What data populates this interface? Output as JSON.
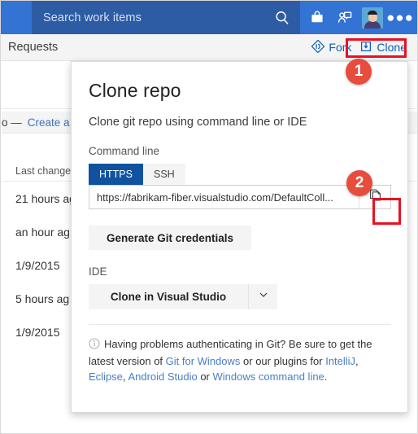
{
  "header": {
    "search_placeholder": "Search work items",
    "icons": [
      "search-icon",
      "marketplace-icon",
      "feedback-icon",
      "avatar",
      "more-actions-icon"
    ],
    "blue_left": "#3273d4",
    "blue_search": "#2d5ca5"
  },
  "subbar": {
    "title": "Requests",
    "fork_label": "Fork",
    "clone_label": "Clone",
    "link_color": "#0a60b5"
  },
  "background": {
    "create_pr_prefix": "o —",
    "create_pr_link": "Create a p",
    "column_header": "Last change",
    "rows": [
      "21 hours ag",
      "an hour ag",
      "1/9/2015",
      "5 hours ag",
      "1/9/2015"
    ]
  },
  "dialog": {
    "title": "Clone repo",
    "subtitle": "Clone git repo using command line or IDE",
    "command_line_label": "Command line",
    "tabs": [
      {
        "label": "HTTPS",
        "active": true
      },
      {
        "label": "SSH",
        "active": false
      }
    ],
    "url_value": "https://fabrikam-fiber.visualstudio.com/DefaultColl...",
    "copy_icon": "copy-icon",
    "generate_button": "Generate Git credentials",
    "ide_label": "IDE",
    "ide_button": "Clone in Visual Studio",
    "ide_caret": "chevron-down-icon",
    "footer": {
      "info_icon": "info-icon",
      "text_1": "Having problems authenticating in Git? Be sure to get the latest version of ",
      "link_1": "Git for Windows",
      "text_2": " or our plugins for ",
      "link_2": "IntelliJ",
      "text_3": ", ",
      "link_3": "Eclipse",
      "text_4": ", ",
      "link_4": "Android Studio",
      "text_5": " or ",
      "link_5": "Windows command line",
      "text_6": "."
    }
  },
  "annotations": {
    "marker_1": "1",
    "marker_2": "2",
    "highlight_color": "#e81123",
    "badge_color": "#e74c3c"
  }
}
